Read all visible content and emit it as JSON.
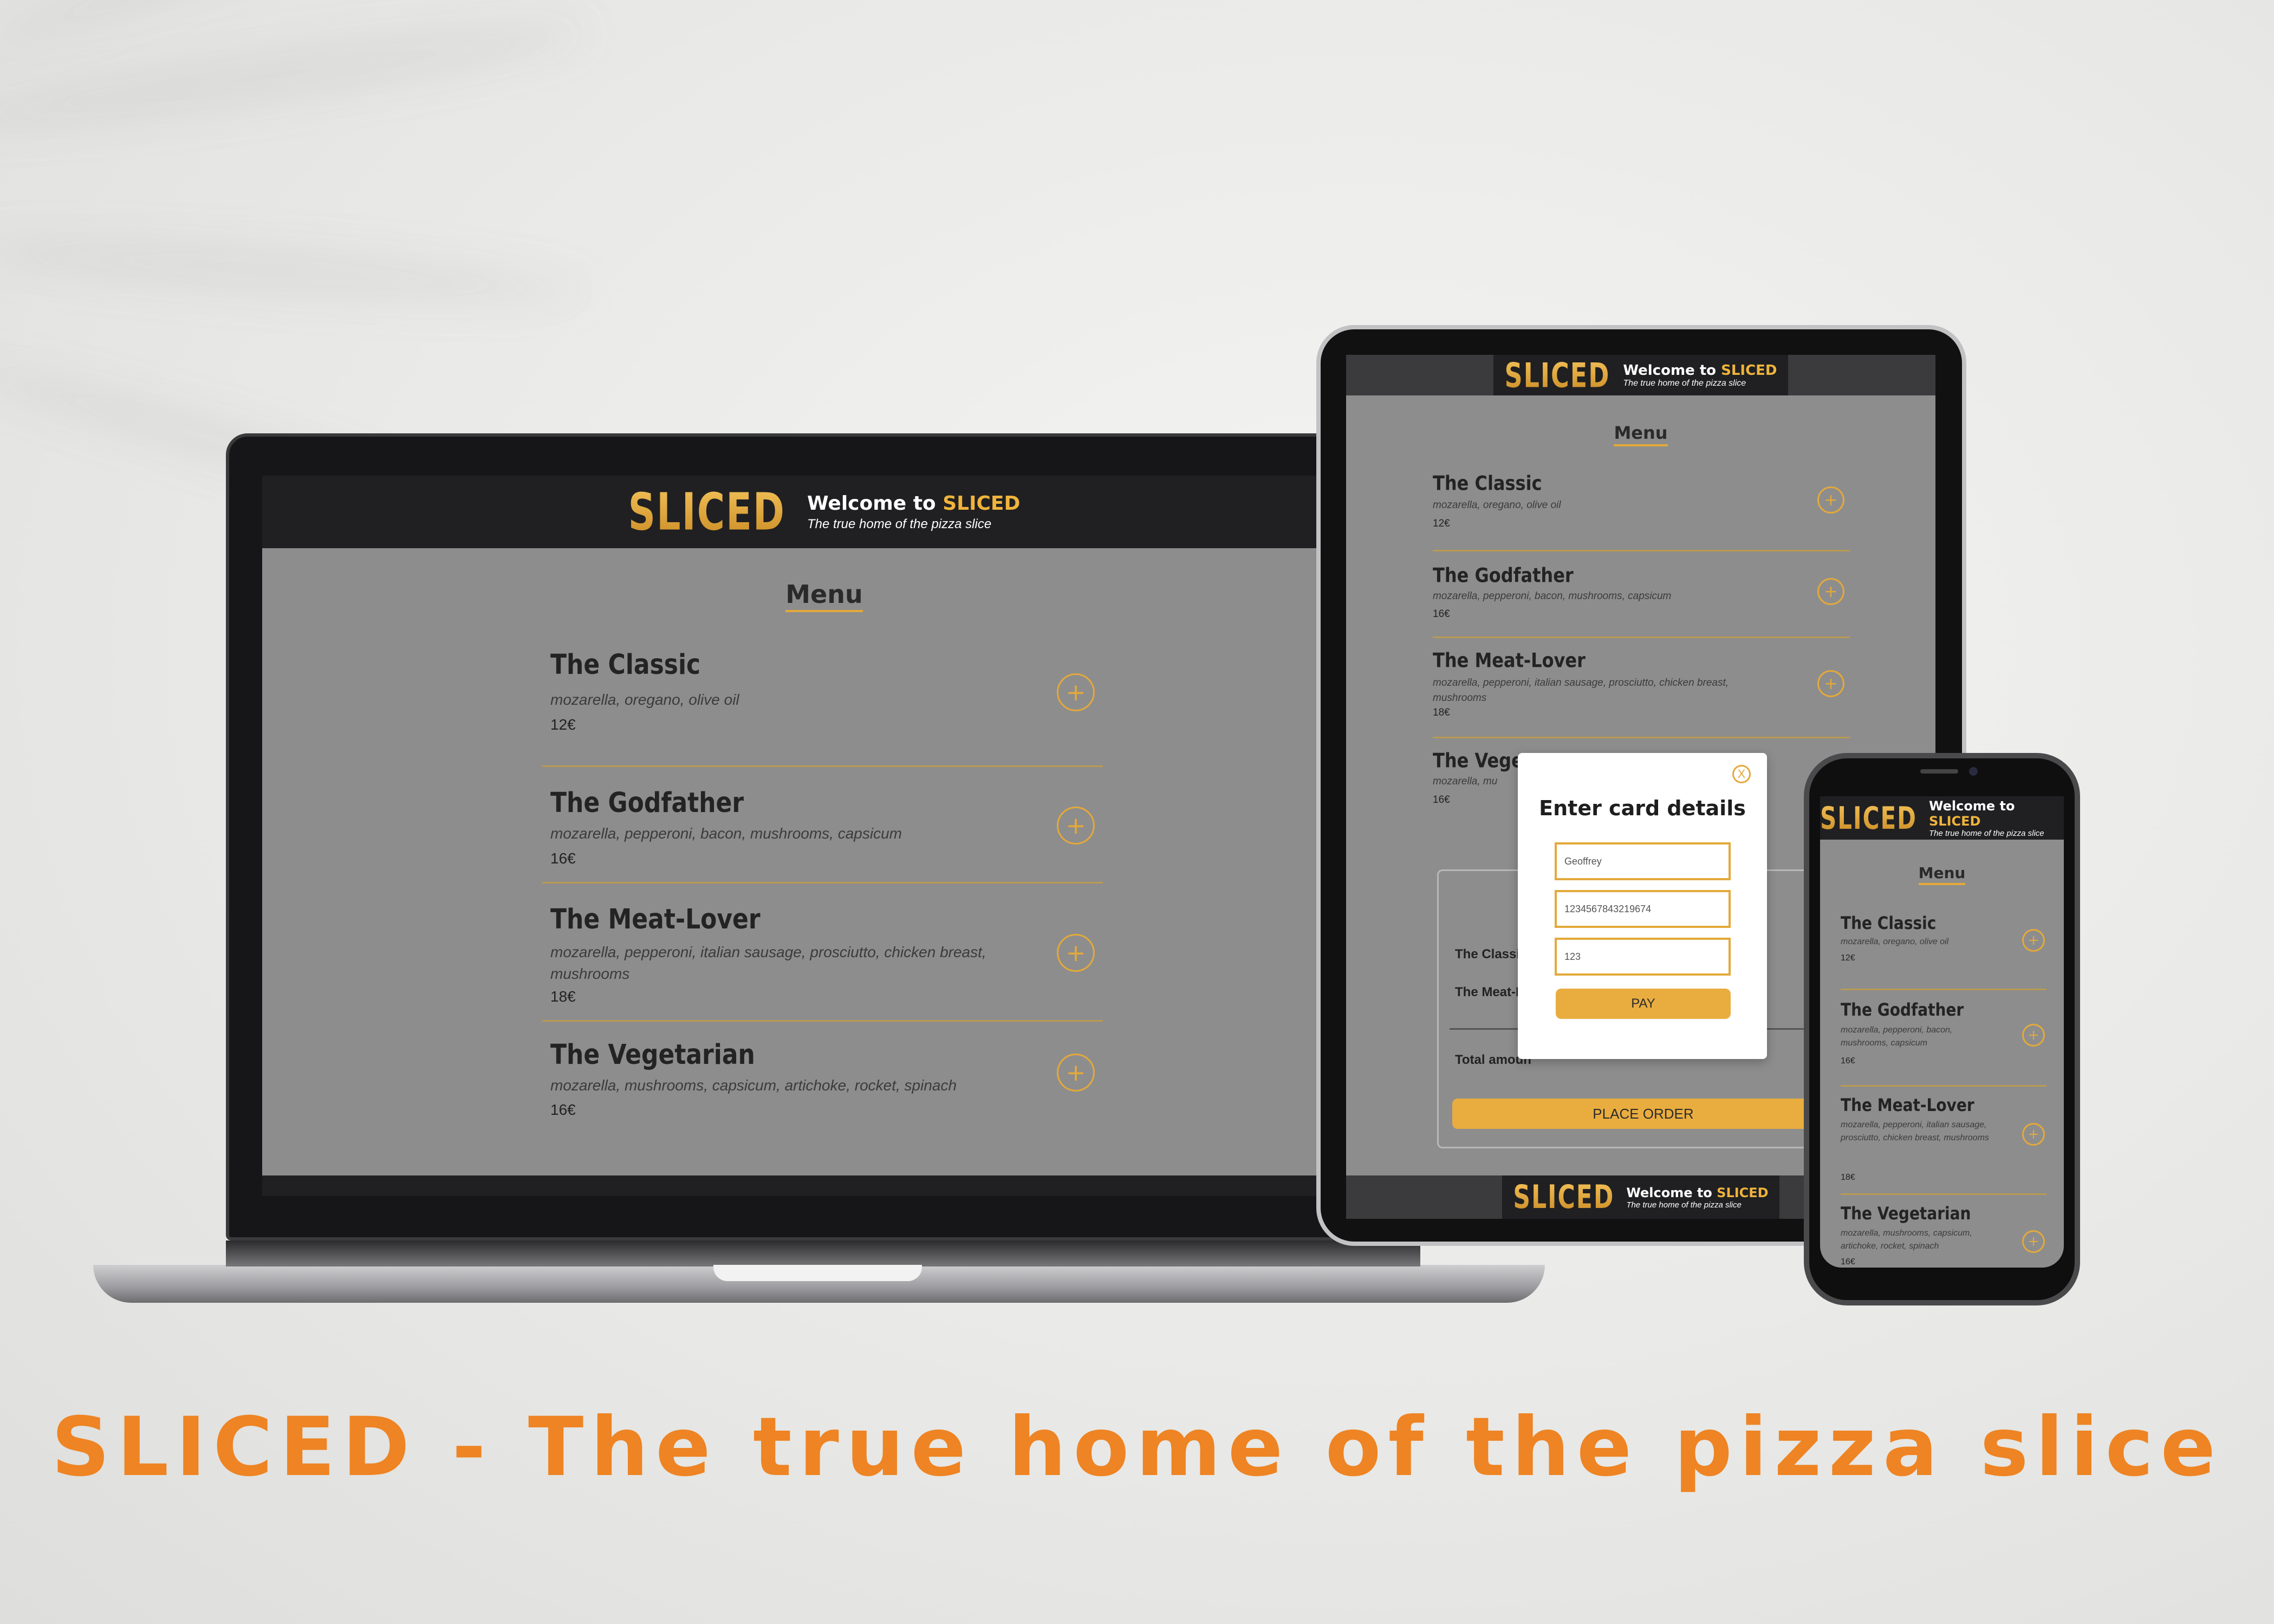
{
  "site": {
    "logo": "SLICED",
    "welcome_prefix": "Welcome to ",
    "welcome_brand": "SLICED",
    "tagline": "The true home of the pizza slice"
  },
  "menu": {
    "title": "Menu",
    "items": [
      {
        "name": "The Classic",
        "desc": "mozarella, oregano, olive oil",
        "price": "12€"
      },
      {
        "name": "The Godfather",
        "desc": "mozarella, pepperoni, bacon, mushrooms, capsicum",
        "price": "16€"
      },
      {
        "name": "The Meat-Lover",
        "desc": "mozarella, pepperoni, italian sausage, prosciutto, chicken breast, mushrooms",
        "price": "18€"
      },
      {
        "name": "The Vegetarian",
        "desc": "mozarella, mushrooms, capsicum, artichoke, rocket, spinach",
        "price": "16€"
      }
    ],
    "add_symbol": "+"
  },
  "tablet": {
    "visible_items": [
      {
        "name": "The Classic",
        "desc": "mozarella, oregano, olive oil",
        "price": "12€"
      },
      {
        "name": "The Godfather",
        "desc": "mozarella, pepperoni, bacon, mushrooms, capsicum",
        "price": "16€"
      },
      {
        "name": "The Meat-Lover",
        "desc": "mozarella, pepperoni, italian sausage, prosciutto, chicken breast, mushrooms",
        "price": "18€"
      },
      {
        "name": "The Veget",
        "desc": "mozarella, mu",
        "price": "16€"
      }
    ],
    "order": {
      "line1": "The Classi",
      "line2": "The Meat-L",
      "total_label": "Total amoun",
      "place_order": "PLACE ORDER"
    },
    "modal": {
      "close": "X",
      "title": "Enter card details",
      "name_value": "Geoffrey",
      "card_value": "1234567843219674",
      "cvc_value": "123",
      "pay": "PAY"
    }
  },
  "phone": {
    "visible_items": [
      {
        "name": "The Classic",
        "desc": "mozarella, oregano, olive oil",
        "price": "12€"
      },
      {
        "name": "The Godfather",
        "desc": "mozarella, pepperoni, bacon, mushrooms, capsicum",
        "price": "16€"
      },
      {
        "name": "The Meat-Lover",
        "desc": "mozarella, pepperoni, italian sausage, prosciutto, chicken breast, mushrooms",
        "price": "18€"
      },
      {
        "name": "The Vegetarian",
        "desc": "mozarella, mushrooms, capsicum, artichoke, rocket, spinach",
        "price": "16€"
      }
    ]
  },
  "headline": "SLICED - The true home of the pizza slice",
  "colors": {
    "accent": "#e9ad3f",
    "headline": "#ee8423",
    "header_bg": "#202022",
    "screen_bg": "#8d8d8d"
  }
}
